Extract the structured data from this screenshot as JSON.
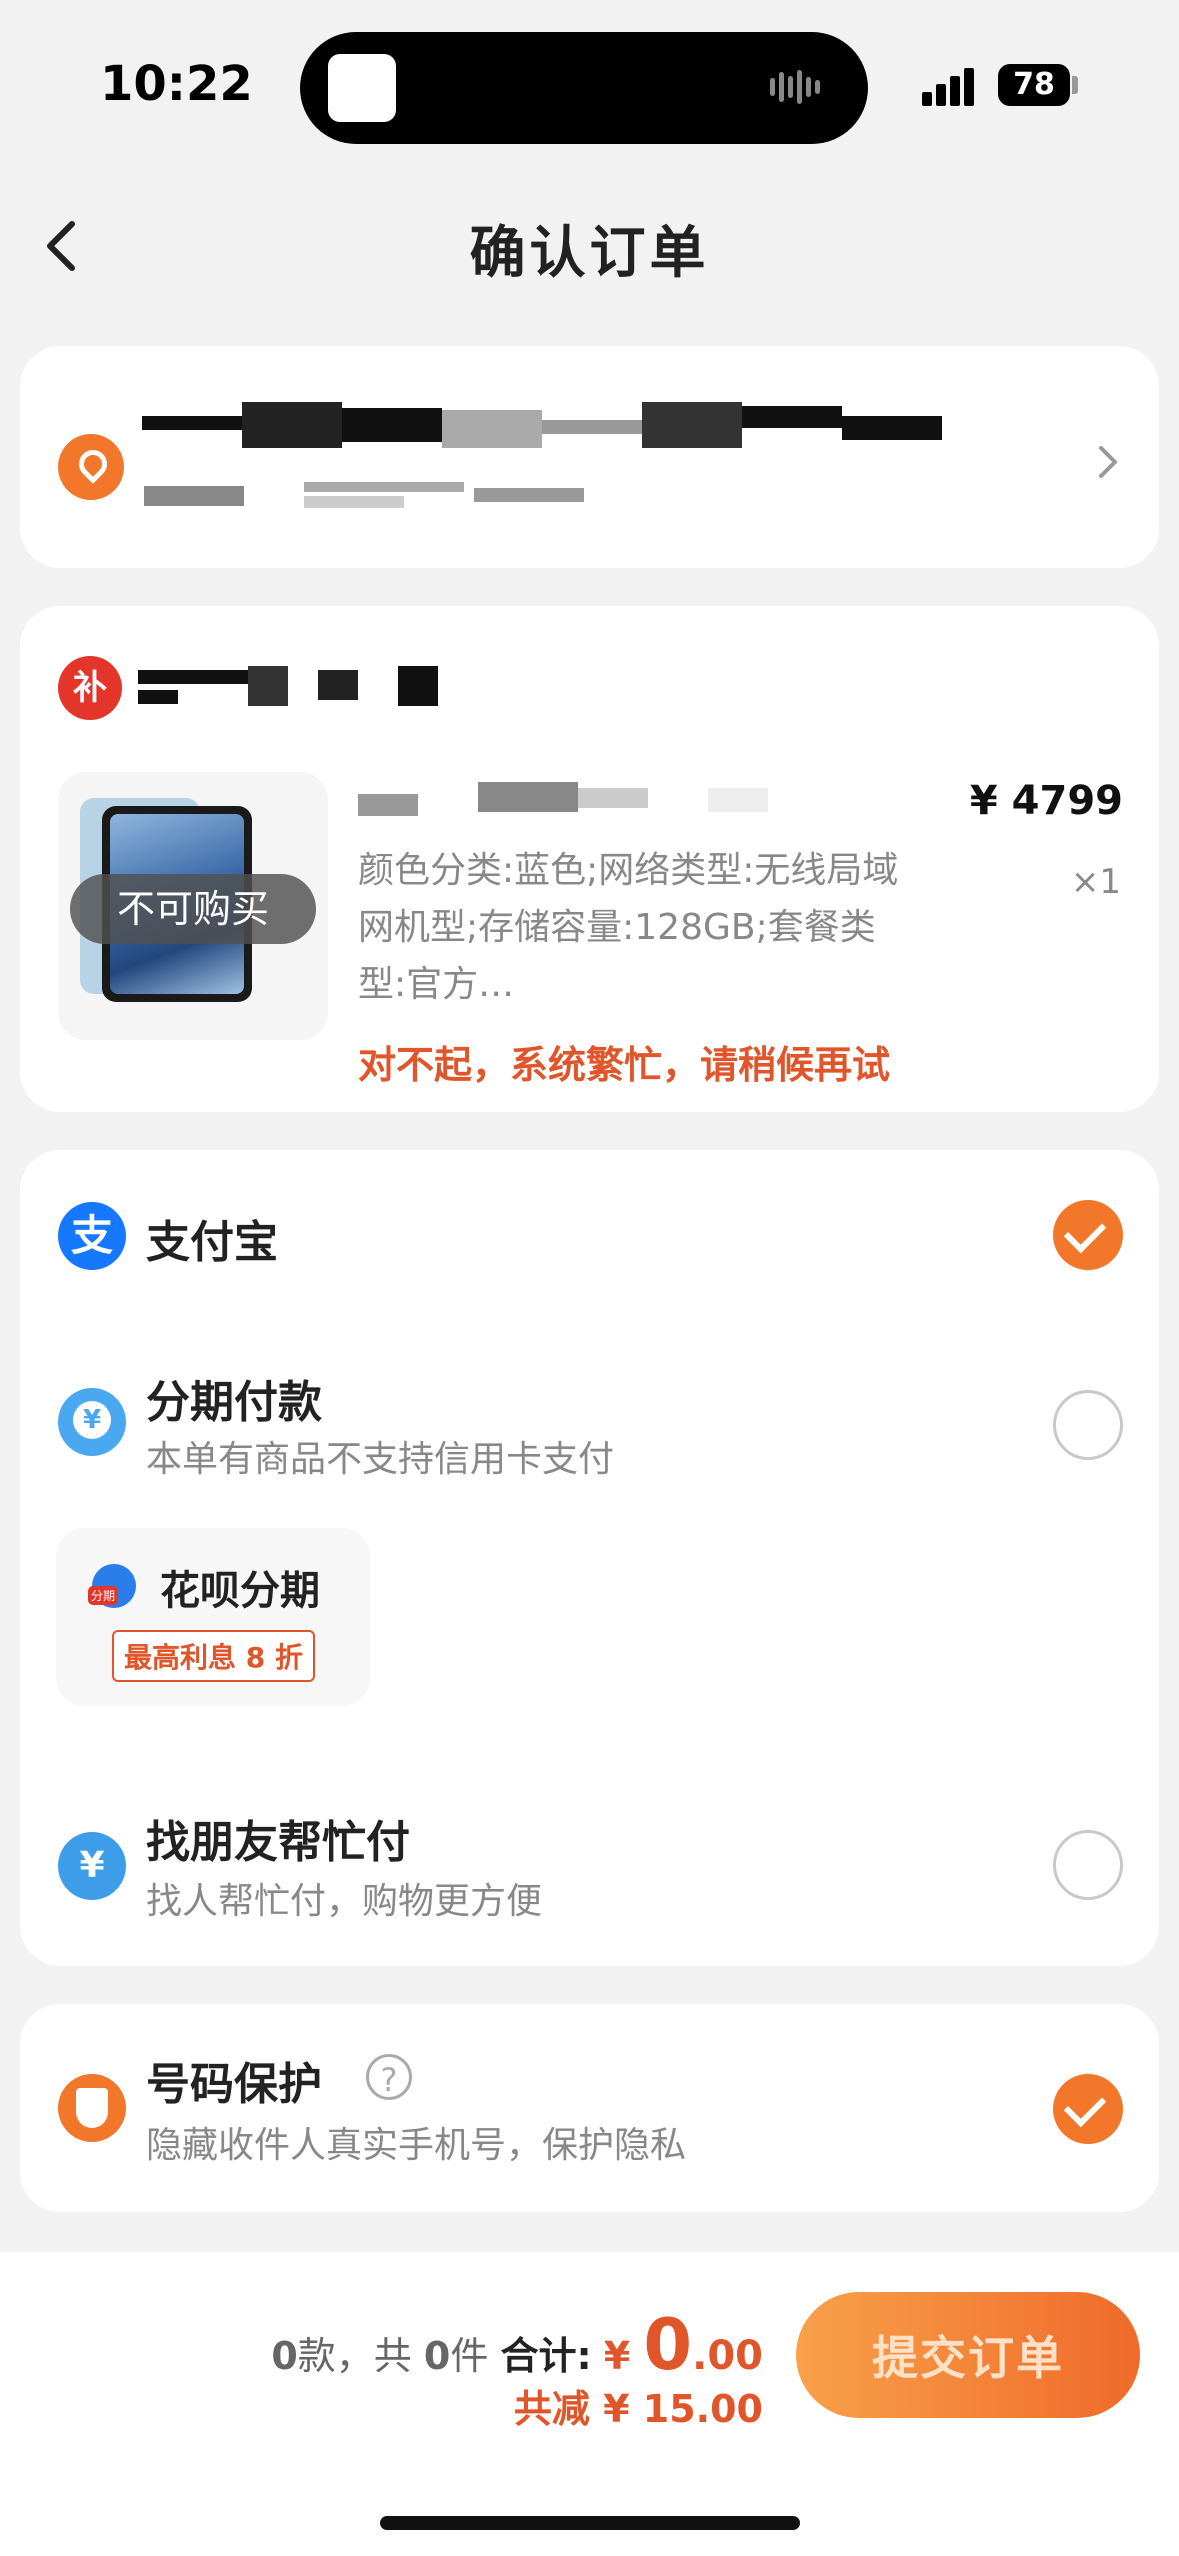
{
  "status_bar": {
    "time": "10:22",
    "battery": "78"
  },
  "nav": {
    "title": "确认订单"
  },
  "shop": {
    "badge": "补"
  },
  "product": {
    "overlay": "不可购买",
    "price": "¥ 4799",
    "qty": "×1",
    "spec": "颜色分类:蓝色;网络类型:无线局域网机型;存储容量:128GB;套餐类型:官方…",
    "error": "对不起，系统繁忙，请稍候再试"
  },
  "payment": {
    "alipay": {
      "label": "支付宝",
      "icon": "支",
      "selected": true
    },
    "installment": {
      "label": "分期付款",
      "sub": "本单有商品不支持信用卡支付",
      "selected": false
    },
    "huabei": {
      "label": "花呗分期",
      "tag": "最高利息 8 折"
    },
    "friend": {
      "label": "找朋友帮忙付",
      "sub": "找人帮忙付，购物更方便",
      "icon": "¥",
      "selected": false
    }
  },
  "privacy": {
    "label": "号码保护",
    "help": "?",
    "sub": "隐藏收件人真实手机号，保护隐私",
    "selected": true
  },
  "footer": {
    "kinds": "0",
    "kinds_unit": "款，共",
    "items": "0",
    "items_unit": "件",
    "total_label": "合计:",
    "currency": "¥",
    "amount_int": "0",
    "amount_dec": ".00",
    "discount": "共减 ¥ 15.00",
    "submit": "提交订单"
  },
  "colors": {
    "accent": "#f2772a",
    "error": "#e0552a",
    "alipay": "#1677ff"
  }
}
